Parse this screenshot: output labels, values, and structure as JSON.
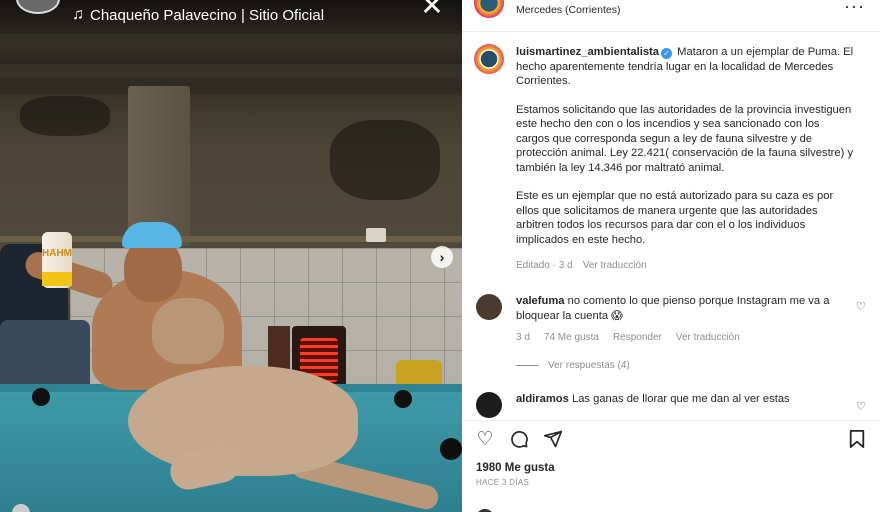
{
  "media": {
    "audio_title": "Chaqueño Palavecino | Sitio Oficial",
    "audio_icon": "music-note-icon",
    "can_text": "HAHM",
    "close_icon": "close-icon",
    "next_icon": "chevron-right-icon"
  },
  "post_header": {
    "location": "Mercedes (Corrientes)",
    "more_icon": "more-horizontal-icon"
  },
  "caption": {
    "username": "luismartinez_ambientalista",
    "verified": true,
    "paragraph1": "Mataron a un ejemplar de Puma. El hecho aparentemente tendría lugar en la localidad de Mercedes Corrientes.",
    "paragraph2": "Estamos solicitando que las autoridades de la provincia investiguen este hecho den con o los incendios y sea sancionado con los cargos que corresponda segun a ley de fauna silvestre y de protección animal. Ley 22.421( conservación de la fauna silvestre) y también la ley 14.346 por maltrató animal.",
    "paragraph3": "Este es un ejemplar que no está autorizado para su caza es por ellos que solicitamos de manera urgente que las autoridades arbitren todos los recursos para dar con el o los individuos implicados en este hecho.",
    "edited": "Editado · 3 d",
    "see_translation": "Ver traducción"
  },
  "comments": [
    {
      "username": "valefuma",
      "text": "no comento lo que pienso porque Instagram me va a bloquear la cuenta 😱",
      "time": "3 d",
      "likes": "74 Me gusta",
      "reply": "Responder",
      "translate": "Ver traducción",
      "view_replies": "Ver respuestas (4)"
    },
    {
      "username": "aldiramos",
      "text": "Las ganas de llorar que me dan al ver estas"
    }
  ],
  "actions": {
    "like_icon": "heart-icon",
    "comment_icon": "comment-icon",
    "share_icon": "send-icon",
    "save_icon": "bookmark-icon",
    "likes_count": "1980 Me gusta",
    "time_ago": "HACE 3 DÍAS"
  },
  "colors": {
    "verified_blue": "#3897f0",
    "secondary_text": "#8e8e8e",
    "pool_felt": "#3e9aa8"
  }
}
